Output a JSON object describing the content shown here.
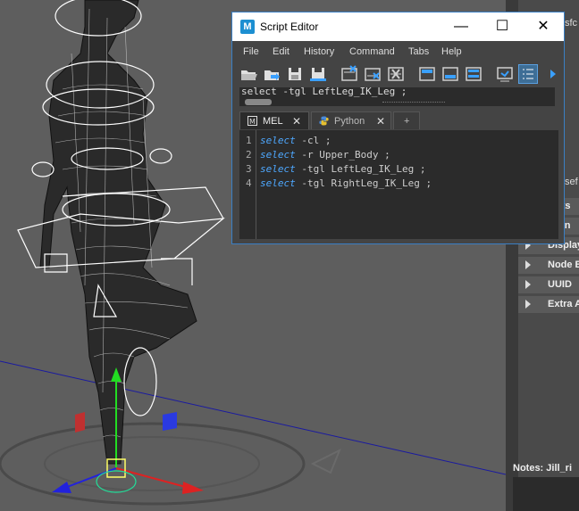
{
  "window": {
    "title": "Script Editor",
    "minimize": "—",
    "maximize": "☐",
    "close": "✕"
  },
  "menu": [
    "File",
    "Edit",
    "History",
    "Command",
    "Tabs",
    "Help"
  ],
  "toolbar_icons": [
    "open-script-icon",
    "source-script-icon",
    "save-script-icon",
    "save-script-shelf-icon",
    "clear-history-icon",
    "clear-input-icon",
    "clear-all-icon",
    "show-history-icon",
    "show-input-icon",
    "show-both-icon",
    "echo-commands-icon",
    "line-numbers-icon",
    "expand-icon"
  ],
  "history": {
    "text": "select -tgl LeftLeg_IK_Leg ;"
  },
  "tabs": [
    {
      "label": "MEL",
      "close": "✕"
    },
    {
      "label": "Python",
      "close": "✕"
    },
    {
      "label": "+"
    }
  ],
  "code": {
    "lines": [
      {
        "num": "1",
        "kw": "select",
        "rest": " -cl  ;"
      },
      {
        "num": "2",
        "kw": "select",
        "rest": " -r Upper_Body ;"
      },
      {
        "num": "3",
        "kw": "select",
        "rest": " -tgl LeftLeg_IK_Leg ;"
      },
      {
        "num": "4",
        "kw": "select",
        "rest": " -tgl RightLeg_IK_Leg ;"
      }
    ]
  },
  "attr_editor": {
    "top_fragment": "sfc",
    "mid_fragment": "sef",
    "fragments": [
      "ots",
      "t In"
    ],
    "sections": [
      "Display",
      "Node B",
      "UUID",
      "Extra A"
    ],
    "notes_label": "Notes:  Jill_ri"
  }
}
